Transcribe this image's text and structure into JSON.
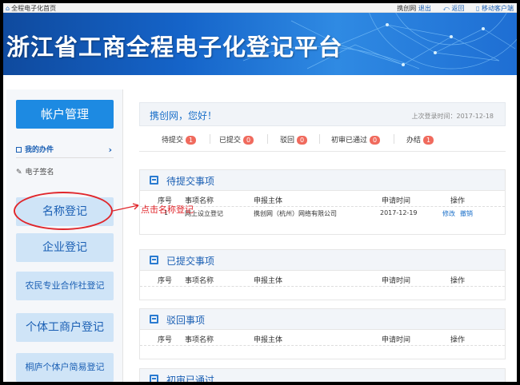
{
  "topbar": {
    "home_label": "全程电子化首页",
    "user": "携创网",
    "logout": "退出",
    "back": "返回",
    "mobile": "移动客户端"
  },
  "banner": {
    "title": "浙江省工商全程电子化登记平台"
  },
  "sidebar": {
    "account": "帐户管理",
    "my_work": "我的办件",
    "esign": "电子签名",
    "buttons": [
      "名称登记",
      "企业登记",
      "农民专业合作社登记",
      "个体工商户登记",
      "桐庐个体户简易登记"
    ]
  },
  "annotation": {
    "text": "点击名称登记"
  },
  "welcome": {
    "hello": "携创网，您好！",
    "last_login_label": "上次登录时间：",
    "last_login": "2017-12-18"
  },
  "stats": [
    {
      "label": "待提交",
      "count": "1"
    },
    {
      "label": "已提交",
      "count": "0"
    },
    {
      "label": "驳回",
      "count": "0"
    },
    {
      "label": "初审已通过",
      "count": "0"
    },
    {
      "label": "办结",
      "count": "1"
    }
  ],
  "columns": {
    "no": "序号",
    "name": "事项名称",
    "subject": "申报主体",
    "time": "申请时间",
    "op": "操作"
  },
  "sections": [
    {
      "title": "待提交事项",
      "rows": [
        {
          "no": "1",
          "name": "网上设立登记",
          "subject": "携创网（杭州）网络有限公司",
          "time": "2017-12-19",
          "edit": "修改",
          "revoke": "撤销"
        }
      ]
    },
    {
      "title": "已提交事项"
    },
    {
      "title": "驳回事项"
    },
    {
      "title": "初审已通过"
    }
  ],
  "colors": {
    "accent": "#1d8ae2",
    "annotation": "#e0262b",
    "badge": "#f06a5d"
  }
}
